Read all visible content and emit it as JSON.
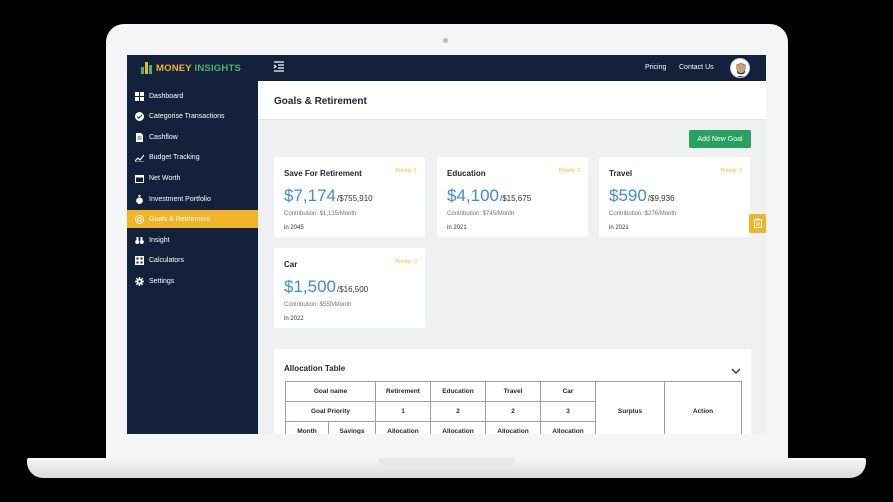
{
  "brand": {
    "name_part1": "MONEY",
    "name_part2": "INSIGHTS",
    "colors": {
      "gold": "#f0b429",
      "green": "#4caf6a",
      "navy": "#13213c",
      "blue": "#3d8bd4",
      "button_green": "#28a060"
    }
  },
  "topnav": {
    "pricing": "Pricing",
    "contact": "Contact Us"
  },
  "sidebar": {
    "items": [
      {
        "label": "Dashboard",
        "icon": "grid-icon"
      },
      {
        "label": "Categorise Transactions",
        "icon": "check-circle-icon"
      },
      {
        "label": "Cashflow",
        "icon": "document-icon"
      },
      {
        "label": "Budget Tracking",
        "icon": "trend-icon"
      },
      {
        "label": "Net Worth",
        "icon": "calendar-icon"
      },
      {
        "label": "Investment Portfolio",
        "icon": "money-bag-icon"
      },
      {
        "label": "Goals & Retirement",
        "icon": "target-icon",
        "active": true
      },
      {
        "label": "Insight",
        "icon": "binoculars-icon"
      },
      {
        "label": "Calculators",
        "icon": "calculator-icon"
      },
      {
        "label": "Settings",
        "icon": "gear-icon"
      }
    ]
  },
  "page": {
    "title": "Goals & Retirement",
    "add_goal": "Add New Goal"
  },
  "goals": [
    {
      "name": "Save For Retirement",
      "priority": "Priority: 1",
      "amount": "$7,174",
      "target": "/$755,910",
      "contribution": "Contribution: $1,135/Month",
      "year": "in 2045"
    },
    {
      "name": "Education",
      "priority": "Priority: 2",
      "amount": "$4,100",
      "target": "/$15,675",
      "contribution": "Contribution: $745/Month",
      "year": "in 2021"
    },
    {
      "name": "Travel",
      "priority": "Priority: 2",
      "amount": "$590",
      "target": "/$9,936",
      "contribution": "Contribution: $276/Month",
      "year": "in 2021"
    },
    {
      "name": "Car",
      "priority": "Priority: 3",
      "amount": "$1,500",
      "target": "/$16,500",
      "contribution": "Contribution: $550/Month",
      "year": "in 2022"
    }
  ],
  "allocation": {
    "title": "Allocation Table",
    "row_goal_name": "Goal name",
    "row_goal_priority": "Goal Priority",
    "goals": [
      "Retirement",
      "Education",
      "Travel",
      "Car"
    ],
    "priorities": [
      "1",
      "2",
      "2",
      "3"
    ],
    "month": "Month",
    "savings": "Savings",
    "allocation": "Allocation",
    "surplus": "Surplus",
    "action": "Action"
  }
}
